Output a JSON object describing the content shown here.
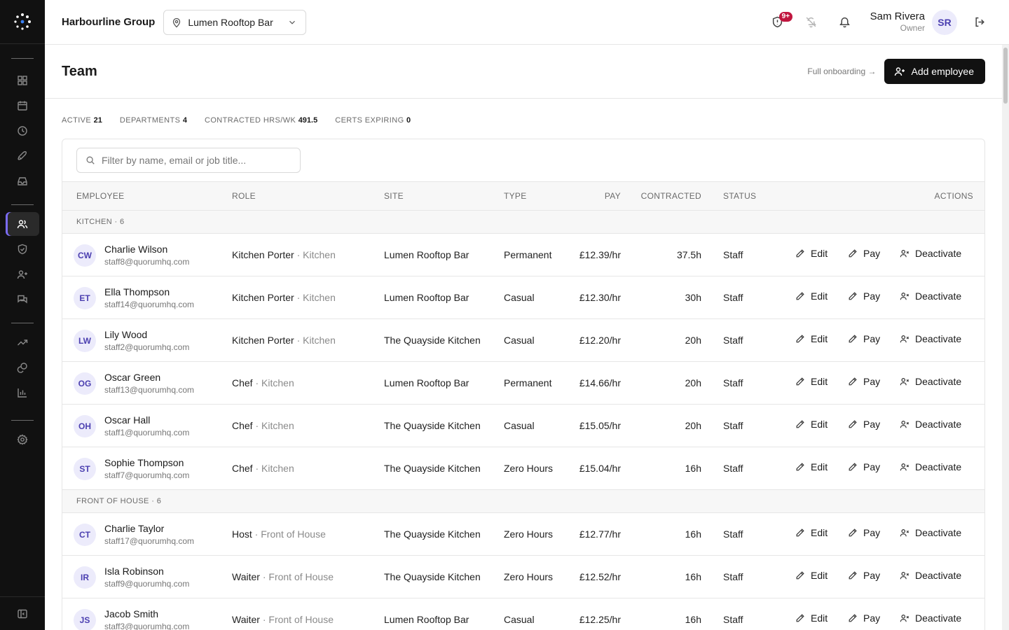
{
  "header": {
    "org_name": "Harbourline Group",
    "site_select": "Lumen Rooftop Bar",
    "alerts_badge": "9+",
    "user_name": "Sam Rivera",
    "user_role": "Owner",
    "user_initials": "SR"
  },
  "page": {
    "title": "Team",
    "onboard_link": "Full onboarding →",
    "add_button": "Add employee"
  },
  "stats": [
    {
      "label": "ACTIVE",
      "value": "21"
    },
    {
      "label": "DEPARTMENTS",
      "value": "4"
    },
    {
      "label": "CONTRACTED HRS/WK",
      "value": "491.5"
    },
    {
      "label": "CERTS EXPIRING",
      "value": "0"
    }
  ],
  "filter": {
    "placeholder": "Filter by name, email or job title..."
  },
  "columns": {
    "employee": "EMPLOYEE",
    "role": "ROLE",
    "site": "SITE",
    "type": "TYPE",
    "pay": "PAY",
    "contracted": "CONTRACTED",
    "status": "STATUS",
    "actions": "ACTIONS"
  },
  "actions": {
    "edit": "Edit",
    "pay": "Pay",
    "deactivate": "Deactivate"
  },
  "groups": [
    {
      "label": "KITCHEN · 6",
      "rows": [
        {
          "initials": "CW",
          "name": "Charlie Wilson",
          "email": "staff8@quorumhq.com",
          "role": "Kitchen Porter",
          "dept": "Kitchen",
          "site": "Lumen Rooftop Bar",
          "type": "Permanent",
          "pay": "£12.39/hr",
          "contracted": "37.5h",
          "status": "Staff"
        },
        {
          "initials": "ET",
          "name": "Ella Thompson",
          "email": "staff14@quorumhq.com",
          "role": "Kitchen Porter",
          "dept": "Kitchen",
          "site": "Lumen Rooftop Bar",
          "type": "Casual",
          "pay": "£12.30/hr",
          "contracted": "30h",
          "status": "Staff"
        },
        {
          "initials": "LW",
          "name": "Lily Wood",
          "email": "staff2@quorumhq.com",
          "role": "Kitchen Porter",
          "dept": "Kitchen",
          "site": "The Quayside Kitchen",
          "type": "Casual",
          "pay": "£12.20/hr",
          "contracted": "20h",
          "status": "Staff"
        },
        {
          "initials": "OG",
          "name": "Oscar Green",
          "email": "staff13@quorumhq.com",
          "role": "Chef",
          "dept": "Kitchen",
          "site": "Lumen Rooftop Bar",
          "type": "Permanent",
          "pay": "£14.66/hr",
          "contracted": "20h",
          "status": "Staff"
        },
        {
          "initials": "OH",
          "name": "Oscar Hall",
          "email": "staff1@quorumhq.com",
          "role": "Chef",
          "dept": "Kitchen",
          "site": "The Quayside Kitchen",
          "type": "Casual",
          "pay": "£15.05/hr",
          "contracted": "20h",
          "status": "Staff"
        },
        {
          "initials": "ST",
          "name": "Sophie Thompson",
          "email": "staff7@quorumhq.com",
          "role": "Chef",
          "dept": "Kitchen",
          "site": "The Quayside Kitchen",
          "type": "Zero Hours",
          "pay": "£15.04/hr",
          "contracted": "16h",
          "status": "Staff"
        }
      ]
    },
    {
      "label": "FRONT OF HOUSE · 6",
      "rows": [
        {
          "initials": "CT",
          "name": "Charlie Taylor",
          "email": "staff17@quorumhq.com",
          "role": "Host",
          "dept": "Front of House",
          "site": "The Quayside Kitchen",
          "type": "Zero Hours",
          "pay": "£12.77/hr",
          "contracted": "16h",
          "status": "Staff"
        },
        {
          "initials": "IR",
          "name": "Isla Robinson",
          "email": "staff9@quorumhq.com",
          "role": "Waiter",
          "dept": "Front of House",
          "site": "The Quayside Kitchen",
          "type": "Zero Hours",
          "pay": "£12.52/hr",
          "contracted": "16h",
          "status": "Staff"
        },
        {
          "initials": "JS",
          "name": "Jacob Smith",
          "email": "staff3@quorumhq.com",
          "role": "Waiter",
          "dept": "Front of House",
          "site": "Lumen Rooftop Bar",
          "type": "Casual",
          "pay": "£12.25/hr",
          "contracted": "16h",
          "status": "Staff"
        }
      ]
    }
  ],
  "icons": {
    "sidebar": [
      "dashboard-icon",
      "calendar-icon",
      "clock-icon",
      "rocket-icon",
      "inbox-icon",
      "team-icon",
      "shield-icon",
      "user-plus-icon",
      "messages-icon",
      "trending-icon",
      "coins-icon",
      "bar-chart-icon",
      "settings-icon",
      "panel-toggle-icon"
    ]
  },
  "colors": {
    "sidebar_bg": "#111111",
    "active_accent": "#7b6cf6",
    "badge": "#c0163f",
    "avatar_bg": "#ecebfb",
    "avatar_text": "#4b3fb0",
    "primary_button": "#111111"
  }
}
